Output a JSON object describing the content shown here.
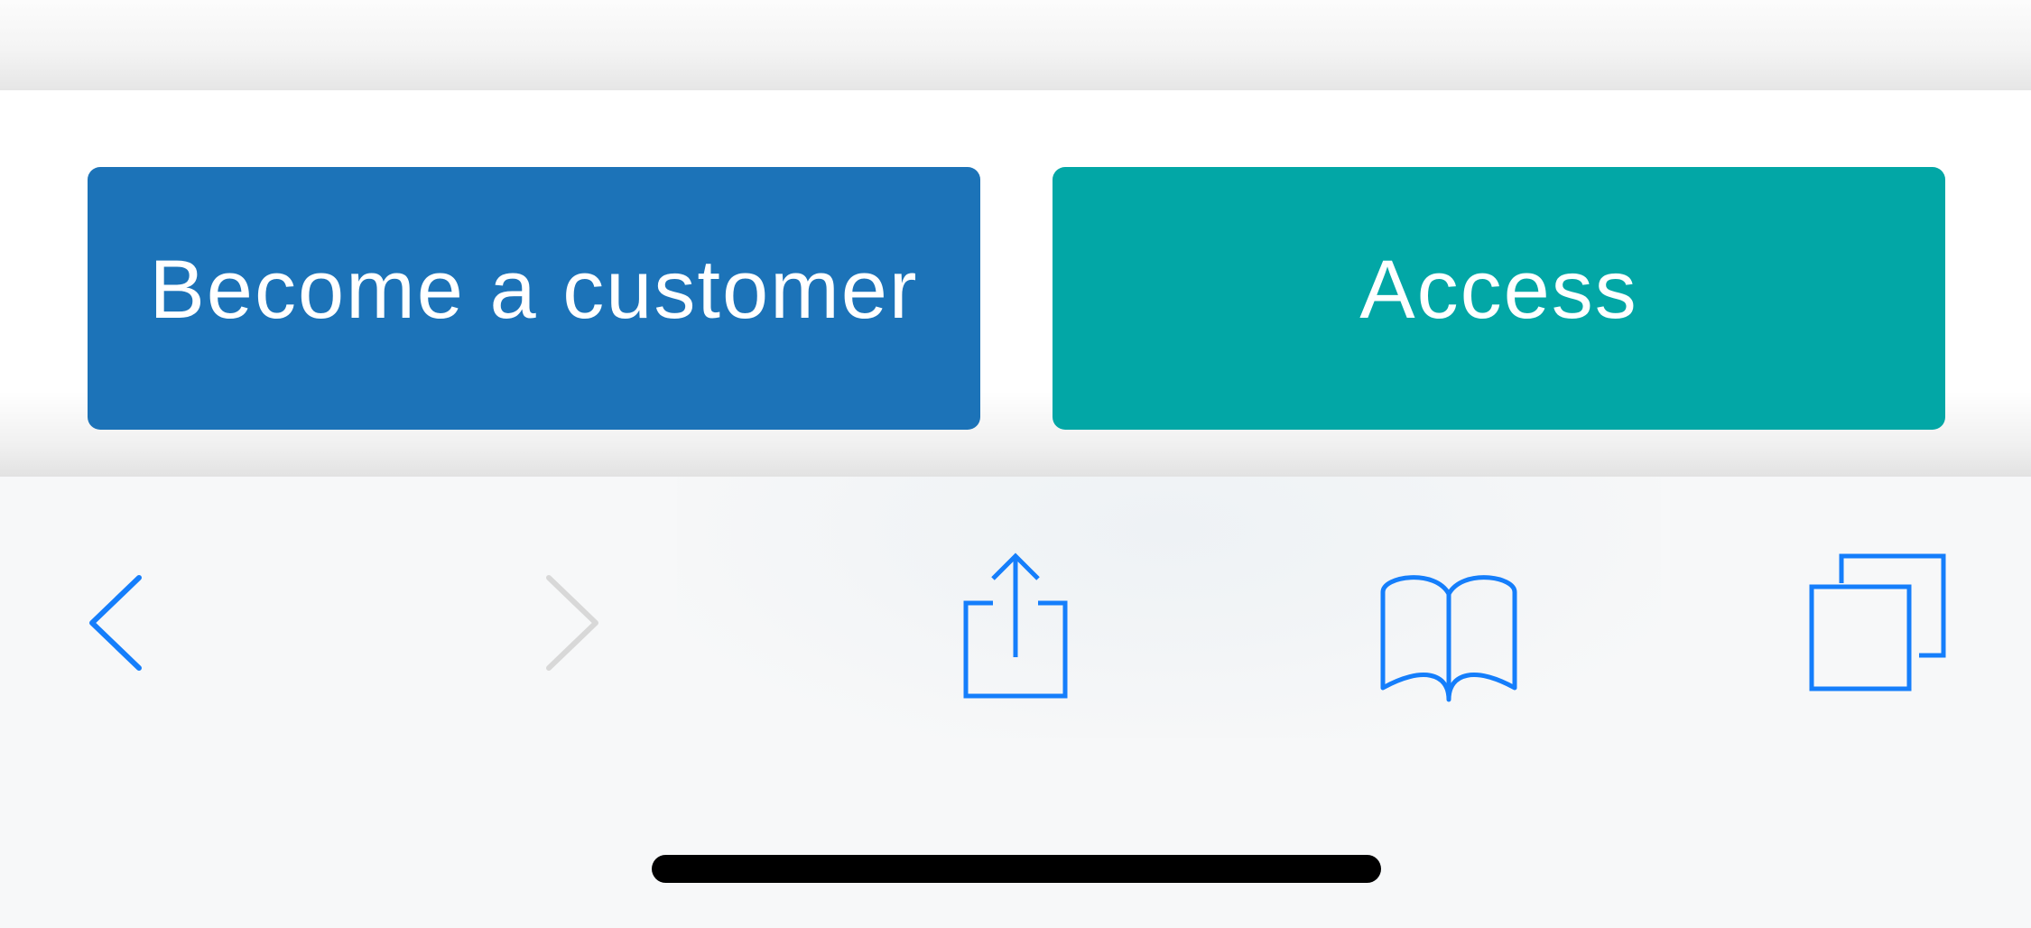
{
  "cta": {
    "become_customer_label": "Become a customer",
    "access_label": "Access",
    "become_customer_color": "#1c73b8",
    "access_color": "#02a7a6"
  },
  "toolbar": {
    "icons": [
      "back-icon",
      "forward-icon",
      "share-icon",
      "bookmarks-icon",
      "tabs-icon"
    ],
    "accent_color": "#157efb",
    "disabled_color": "#d8d8d8",
    "forward_enabled": false
  }
}
